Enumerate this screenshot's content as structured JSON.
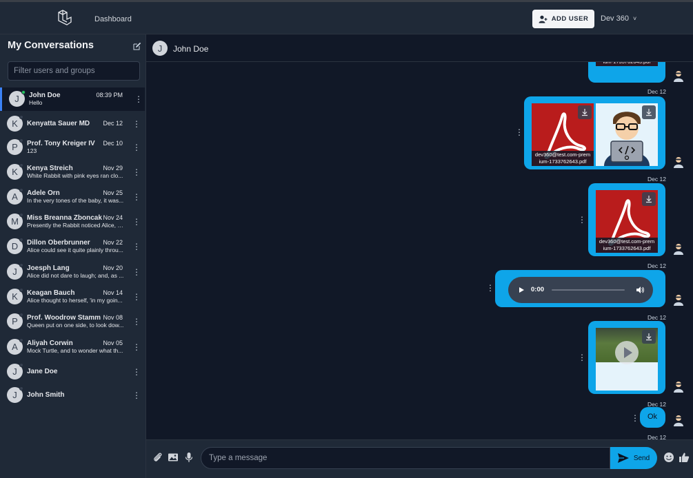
{
  "topbar": {
    "nav_dashboard": "Dashboard",
    "add_user_label": "ADD USER",
    "user_name": "Dev 360",
    "chevron": "˅"
  },
  "sidebar": {
    "title": "My Conversations",
    "filter_placeholder": "Filter users and groups",
    "conversations": [
      {
        "initial": "J",
        "name": "John Doe",
        "date": "08:39 PM",
        "message": "Hello",
        "online": true,
        "active": true
      },
      {
        "initial": "K",
        "name": "Kenyatta Sauer MD",
        "date": "Dec 12",
        "message": ""
      },
      {
        "initial": "P",
        "name": "Prof. Tony Kreiger IV",
        "date": "Dec 10",
        "message": "123"
      },
      {
        "initial": "K",
        "name": "Kenya Streich",
        "date": "Nov 29",
        "message": "White Rabbit with pink eyes ran clo..."
      },
      {
        "initial": "A",
        "name": "Adele Orn",
        "date": "Nov 25",
        "message": "In the very tones of the baby, it was..."
      },
      {
        "initial": "M",
        "name": "Miss Breanna Zboncak",
        "date": "Nov 24",
        "message": "Presently the Rabbit noticed Alice, a..."
      },
      {
        "initial": "D",
        "name": "Dillon Oberbrunner",
        "date": "Nov 22",
        "message": "Alice could see it quite plainly throu..."
      },
      {
        "initial": "J",
        "name": "Joesph Lang",
        "date": "Nov 20",
        "message": "Alice did not dare to laugh; and, as ..."
      },
      {
        "initial": "K",
        "name": "Keagan Bauch",
        "date": "Nov 14",
        "message": "Alice thought to herself, 'in my goin..."
      },
      {
        "initial": "P",
        "name": "Prof. Woodrow Stamm",
        "date": "Nov 08",
        "message": "Queen put on one side, to look dow..."
      },
      {
        "initial": "A",
        "name": "Aliyah Corwin",
        "date": "Nov 05",
        "message": "Mock Turtle, and to wonder what th..."
      },
      {
        "initial": "J",
        "name": "Jane Doe",
        "date": "",
        "message": ""
      },
      {
        "initial": "J",
        "name": "John Smith",
        "date": "",
        "message": ""
      }
    ]
  },
  "chat": {
    "header_initial": "J",
    "header_name": "John Doe",
    "pdf_caption_line1": "dev360@test.com-prem",
    "pdf_caption_line2": "ium-1733762643.pdf",
    "dates": [
      "Dec 12",
      "Dec 12",
      "Dec 12",
      "Dec 12",
      "Dec 12",
      "Dec 12"
    ],
    "audio_time": "0:00",
    "text_message": "Ok"
  },
  "composer": {
    "placeholder": "Type a message",
    "send_label": "Send"
  },
  "colors": {
    "accent": "#0ea5e9",
    "pdf_red": "#b91c1c",
    "online": "#22c55e"
  },
  "icons": [
    "laravel-logo",
    "add-user-icon",
    "edit-icon",
    "kebab-icon",
    "download-icon",
    "play-icon",
    "volume-icon",
    "paperclip-icon",
    "image-icon",
    "microphone-icon",
    "send-icon",
    "emoji-icon",
    "thumbs-up-icon",
    "avatar-icon"
  ]
}
